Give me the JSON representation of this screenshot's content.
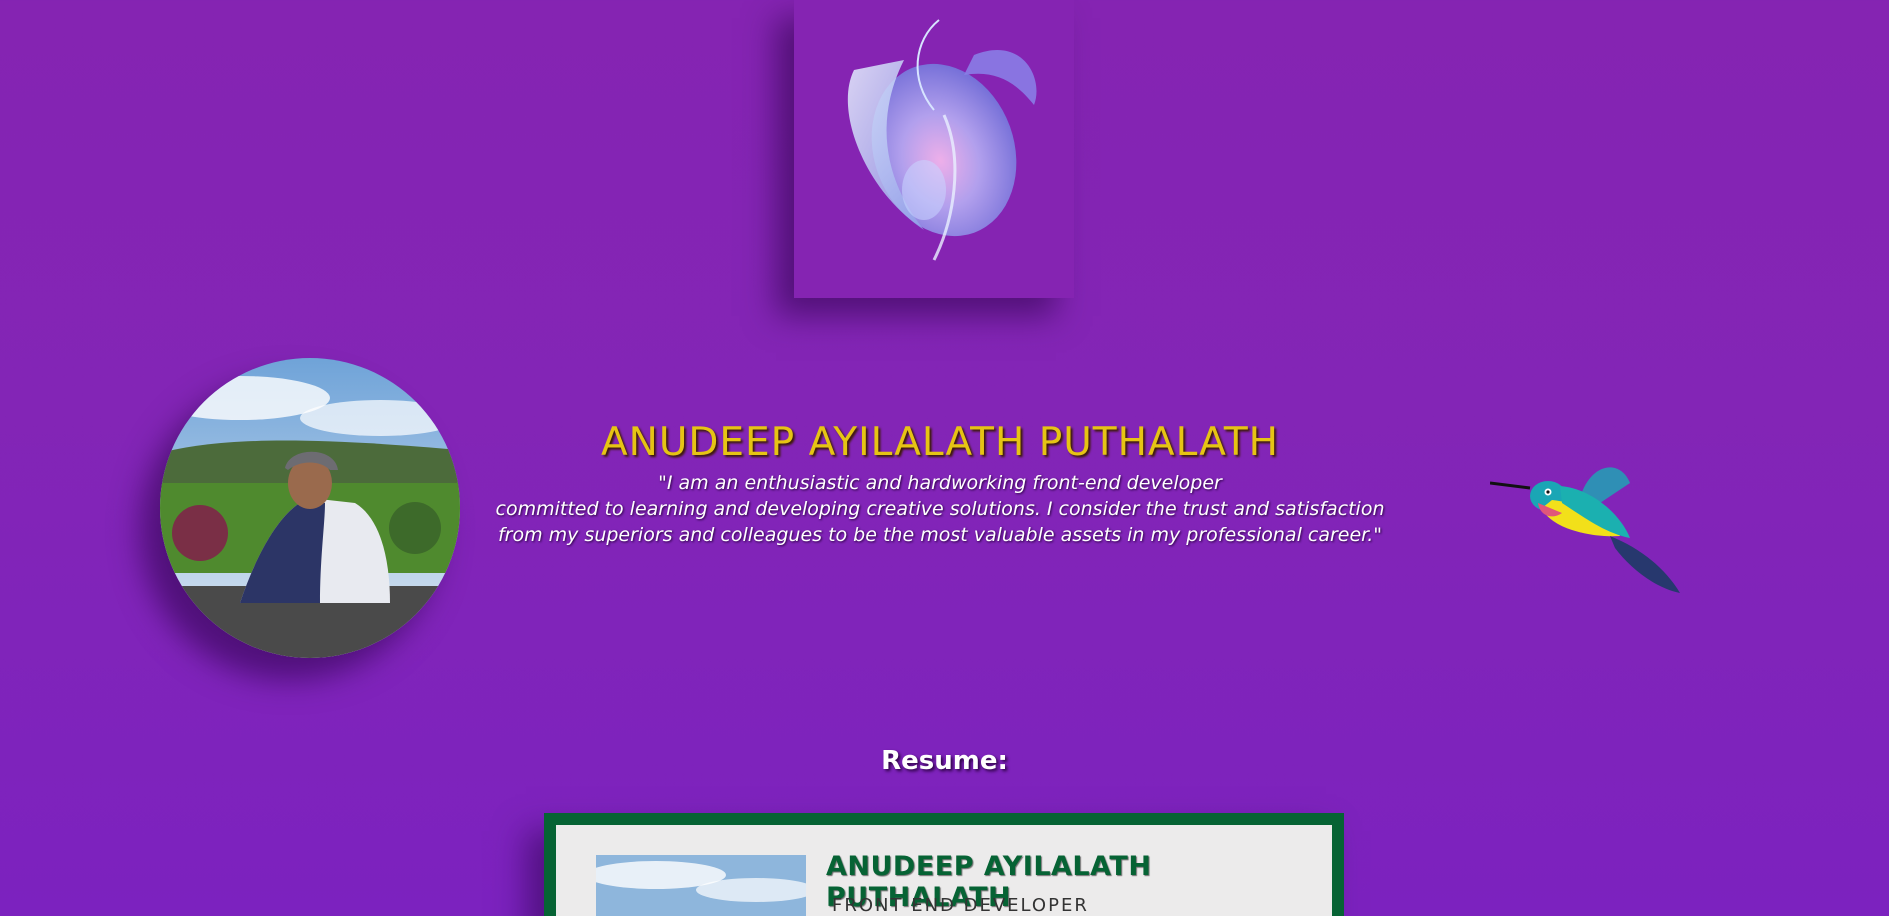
{
  "hero": {
    "name": "ANUDEEP AYILALATH PUTHALATH",
    "quote_lines": [
      "\"I am an enthusiastic and hardworking front-end developer",
      "committed to learning and developing creative solutions. I consider the trust and satisfaction",
      "from my superiors and colleagues to be the most valuable assets in my professional career.\""
    ]
  },
  "resume": {
    "heading": "Resume:",
    "name": "ANUDEEP AYILALATH PUTHALATH",
    "role": "FRONT END DEVELOPER"
  },
  "icons": {
    "logo": "abstract-sphere-logo-icon",
    "bird": "hummingbird-icon"
  },
  "colors": {
    "background": "#8524b2",
    "name_gold": "#e6c414",
    "resume_green": "#066334"
  }
}
